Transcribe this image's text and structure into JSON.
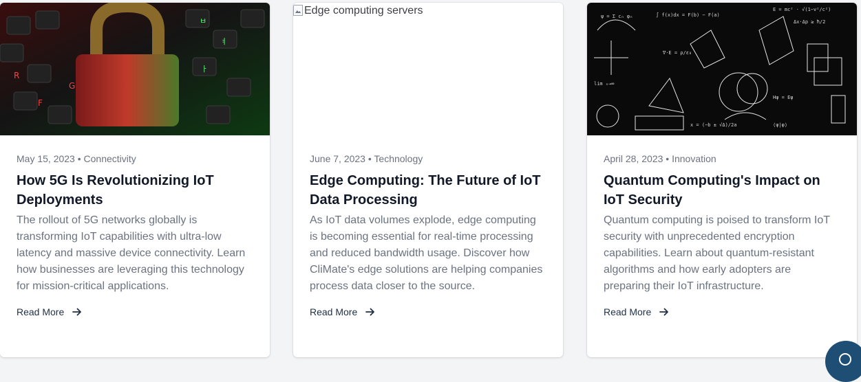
{
  "articles": [
    {
      "image_alt": "Cybersecurity padlock on keyboard",
      "image_icon": "padlock-keyboard-image",
      "date": "May 15, 2023",
      "category": "Connectivity",
      "title": "How 5G Is Revolutionizing IoT Deployments",
      "excerpt": "The rollout of 5G networks globally is transforming IoT capabilities with ultra-low latency and massive device connectivity. Learn how businesses are leveraging this technology for mission-critical applications.",
      "read_more": "Read More"
    },
    {
      "image_alt": "Edge computing servers",
      "image_icon": "broken-image-icon",
      "date": "June 7, 2023",
      "category": "Technology",
      "title": "Edge Computing: The Future of IoT Data Processing",
      "excerpt": "As IoT data volumes explode, edge computing is becoming essential for real-time processing and reduced bandwidth usage. Discover how CliMate's edge solutions are helping companies process data closer to the source.",
      "read_more": "Read More"
    },
    {
      "image_alt": "Quantum computing formulas on blackboard",
      "image_icon": "blackboard-formulas-image",
      "date": "April 28, 2023",
      "category": "Innovation",
      "title": "Quantum Computing's Impact on IoT Security",
      "excerpt": "Quantum computing is poised to transform IoT security with unprecedented encryption capabilities. Learn about quantum-resistant algorithms and how early adopters are preparing their IoT infrastructure.",
      "read_more": "Read More"
    }
  ],
  "meta_separator": "•",
  "chat_button": {
    "icon": "chat-icon"
  },
  "colors": {
    "title": "#111827",
    "muted": "#6b7280",
    "link": "#1f2f46",
    "fab": "#1f4e74"
  }
}
